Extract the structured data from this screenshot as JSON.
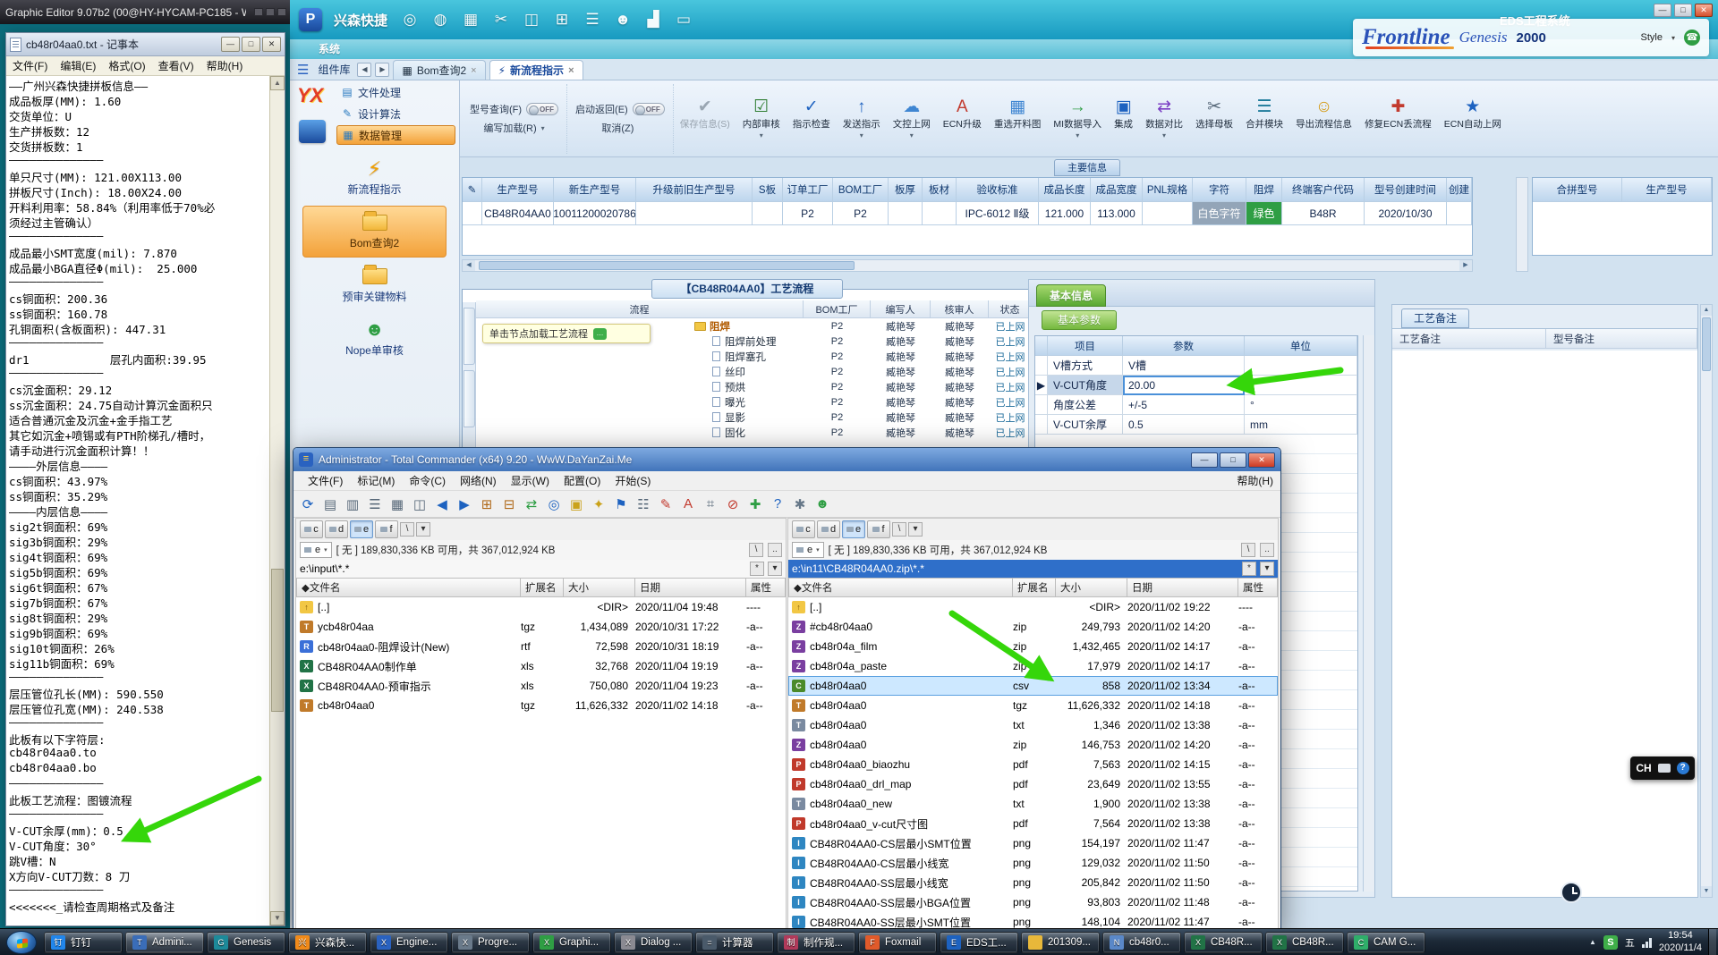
{
  "colors": {
    "arrow": "#35d60a",
    "teal": "#179ac0",
    "accent_orange": "#f3a23a",
    "selection_blue": "#cde8ff"
  },
  "graphic_editor": {
    "title": "Graphic Editor 9.07b2 (00@HY-HYCAM-PC185 - W..."
  },
  "notepad": {
    "title": "cb48r04aa0.txt - 记事本",
    "controls": [
      "—",
      "□",
      "✕"
    ],
    "menu": [
      "文件(F)",
      "编辑(E)",
      "格式(O)",
      "查看(V)",
      "帮助(H)"
    ],
    "lines": [
      "——广州兴森快捷拼板信息——",
      "成品板厚(MM): 1.60",
      "交货单位：U",
      "生产拼板数：12",
      "交货拼板数：1",
      "——————————————",
      "单只尺寸(MM): 121.00X113.00",
      "拼板尺寸(Inch): 18.00X24.00",
      "开料利用率：58.84%（利用率低于70%必",
      "须经过主管确认）",
      "——————————————",
      "成品最小SMT宽度(mil): 7.870",
      "成品最小BGA直径Φ(mil):  25.000",
      "——————————————",
      "cs铜面积：200.36",
      "ss铜面积：160.78",
      "孔铜面积(含板面积): 447.31",
      "——————————————",
      "dr1            层孔内面积:39.95",
      "——————————————",
      "cs沉金面积：29.12",
      "ss沉金面积：24.75自动计算沉金面积只",
      "适合普通沉金及沉金+金手指工艺",
      "其它如沉金+喷锡或有PTH阶梯孔/槽时，",
      "请手动进行沉金面积计算！！",
      "————外层信息————",
      "cs铜面积：43.97%",
      "ss铜面积：35.29%",
      "————内层信息————",
      "sig2t铜面积：69%",
      "sig3b铜面积：29%",
      "sig4t铜面积：69%",
      "sig5b铜面积：69%",
      "sig6t铜面积：67%",
      "sig7b铜面积：67%",
      "sig8t铜面积：29%",
      "sig9b铜面积：69%",
      "sig10t铜面积：26%",
      "sig11b铜面积：69%",
      "——————————————",
      "层压管位孔长(MM): 590.550",
      "层压管位孔宽(MM): 240.538",
      "——————————————",
      "此板有以下字符层:",
      "cb48r04aa0.to",
      "cb48r04aa0.bo",
      "——————————————",
      "此板工艺流程：图镀流程",
      "——————————————",
      "V-CUT余厚(mm)：0.5",
      "V-CUT角度：30°",
      "跳V槽：N",
      "X方向V-CUT刀数：8 刀",
      "——————————————",
      "<<<<<<<_请检查周期格式及备注"
    ]
  },
  "eds": {
    "title": "EDS工程系统",
    "logo": "P",
    "brandname": "兴森快捷",
    "controls": [
      "—",
      "□",
      "✕"
    ],
    "toolbar_icons": [
      {
        "n": "search-icon",
        "g": "◎"
      },
      {
        "n": "globe-icon",
        "g": "◍"
      },
      {
        "n": "table-icon",
        "g": "▦"
      },
      {
        "n": "cut-icon",
        "g": "✂"
      },
      {
        "n": "split-icon",
        "g": "◫"
      },
      {
        "n": "copy-icon",
        "g": "⊞"
      },
      {
        "n": "list-icon",
        "g": "☰"
      },
      {
        "n": "user-icon",
        "g": "☻"
      },
      {
        "n": "chart-icon",
        "g": "▟"
      },
      {
        "n": "window-icon",
        "g": "▭"
      }
    ],
    "frontline": {
      "name": "Frontline",
      "product": "Genesis",
      "year": "2000",
      "style": "Style",
      "caret": "▾",
      "phone": "☎"
    },
    "system_tab": "系统",
    "burger": "☰",
    "component_lib": "组件库",
    "nav_prev": "◀",
    "nav_next": "▶",
    "tabs": [
      {
        "g": "▦",
        "label": "Bom查询2",
        "close": "×",
        "cls": ""
      },
      {
        "g": "⚡",
        "label": "新流程指示",
        "close": "×",
        "cls": "active"
      }
    ],
    "toggles": [
      {
        "top": "型号查询(F)",
        "state": "OFF",
        "bottom": "编写加载(R)",
        "caret": "▾"
      },
      {
        "top": "启动返回(E)",
        "state": "OFF",
        "bottom": "取消(Z)",
        "caret": ""
      }
    ],
    "ribbon": [
      {
        "label": "保存信息(S)",
        "g": "✔",
        "c": "#9aa6b2",
        "caret": "",
        "cls": "disabled"
      },
      {
        "label": "内部审核",
        "g": "☑",
        "c": "#2f7d32",
        "caret": "▾",
        "cls": ""
      },
      {
        "label": "指示检查",
        "g": "✓",
        "c": "#1d62c0",
        "caret": "",
        "cls": ""
      },
      {
        "label": "发送指示",
        "g": "↑",
        "c": "#1d62c0",
        "caret": "▾",
        "cls": ""
      },
      {
        "label": "文控上网",
        "g": "☁",
        "c": "#3f86d2",
        "caret": "▾",
        "cls": ""
      },
      {
        "label": "ECN升级",
        "g": "A",
        "c": "#c23a2e",
        "caret": "",
        "cls": ""
      },
      {
        "label": "重选开料图",
        "g": "▦",
        "c": "#3f86d2",
        "caret": "",
        "cls": ""
      },
      {
        "label": "MI数据导入",
        "g": "→",
        "c": "#2f9e44",
        "caret": "▾",
        "cls": ""
      },
      {
        "label": "集成",
        "g": "▣",
        "c": "#1d62c0",
        "caret": "",
        "cls": ""
      },
      {
        "label": "数据对比",
        "g": "⇄",
        "c": "#7b3fc4",
        "caret": "▾",
        "cls": ""
      },
      {
        "label": "选择母板",
        "g": "✂",
        "c": "#556677",
        "caret": "",
        "cls": ""
      },
      {
        "label": "合并模块",
        "g": "☰",
        "c": "#1d7a9a",
        "caret": "",
        "cls": ""
      },
      {
        "label": "导出流程信息",
        "g": "☺",
        "c": "#d49a12",
        "caret": "",
        "cls": ""
      },
      {
        "label": "修复ECN丢流程",
        "g": "✚",
        "c": "#c23a2e",
        "caret": "",
        "cls": ""
      },
      {
        "label": "ECN自动上网",
        "g": "★",
        "c": "#1d62c0",
        "caret": "",
        "cls": ""
      }
    ],
    "sidebar": {
      "logo": "YX",
      "menu": [
        {
          "label": "文件处理",
          "g": "▤",
          "cls": ""
        },
        {
          "label": "设计算法",
          "g": "✎",
          "cls": ""
        },
        {
          "label": "数据管理",
          "g": "▦",
          "cls": "sel"
        }
      ],
      "items": [
        {
          "label": "新流程指示",
          "icon": "itm-bolt",
          "cls": ""
        },
        {
          "label": "Bom查询2",
          "icon": "itm-folder",
          "cls": "sel"
        },
        {
          "label": "预审关键物料",
          "icon": "itm-folder",
          "cls": ""
        },
        {
          "label": "Nope单审核",
          "icon": "itm-person",
          "cls": ""
        }
      ]
    },
    "main_info": "主要信息",
    "grid": {
      "gutter_glyph": "✎",
      "headers": [
        "生产型号",
        "新生产型号",
        "升级前旧生产型号",
        "S板",
        "订单工厂",
        "BOM工厂",
        "板厚",
        "板材",
        "验收标准",
        "成品长度",
        "成品宽度",
        "PNL规格",
        "字符",
        "阻焊",
        "终端客户代码",
        "型号创建时间",
        "创建"
      ],
      "row": {
        "c0": "CB48R04AA0",
        "c1": "10011200020786",
        "c2": "",
        "c3": "",
        "c4": "P2",
        "c5": "P2",
        "c6": "",
        "c7": "",
        "c8": "IPC-6012 Ⅱ级",
        "c9": "121.000",
        "c10": "113.000",
        "c11": "",
        "c12": "白色字符",
        "c13": "绿色",
        "c14": "B48R",
        "c15": "2020/10/30",
        "c16": ""
      },
      "extra_headers": [
        "合拼型号",
        "生产型号"
      ]
    },
    "process": {
      "title": "【CB48R04AA0】工艺流程",
      "headers": [
        "流程",
        "BOM工厂",
        "编写人",
        "核审人",
        "状态"
      ],
      "tooltip": "单击节点加载工艺流程",
      "rows": [
        {
          "name": "阻焊",
          "lvl": "lvl0",
          "icon": "node-folder",
          "f": "P2",
          "w": "臧艳琴",
          "r": "臧艳琴",
          "s": "已上网"
        },
        {
          "name": "阻焊前处理",
          "lvl": "lvl1",
          "icon": "node-doc",
          "f": "P2",
          "w": "臧艳琴",
          "r": "臧艳琴",
          "s": "已上网"
        },
        {
          "name": "阻焊塞孔",
          "lvl": "lvl1",
          "icon": "node-doc",
          "f": "P2",
          "w": "臧艳琴",
          "r": "臧艳琴",
          "s": "已上网"
        },
        {
          "name": "丝印",
          "lvl": "lvl1",
          "icon": "node-doc",
          "f": "P2",
          "w": "臧艳琴",
          "r": "臧艳琴",
          "s": "已上网"
        },
        {
          "name": "预烘",
          "lvl": "lvl1",
          "icon": "node-doc",
          "f": "P2",
          "w": "臧艳琴",
          "r": "臧艳琴",
          "s": "已上网"
        },
        {
          "name": "曝光",
          "lvl": "lvl1",
          "icon": "node-doc",
          "f": "P2",
          "w": "臧艳琴",
          "r": "臧艳琴",
          "s": "已上网"
        },
        {
          "name": "显影",
          "lvl": "lvl1",
          "icon": "node-doc",
          "f": "P2",
          "w": "臧艳琴",
          "r": "臧艳琴",
          "s": "已上网"
        },
        {
          "name": "固化",
          "lvl": "lvl1",
          "icon": "node-doc",
          "f": "P2",
          "w": "臧艳琴",
          "r": "臧艳琴",
          "s": "已上网"
        }
      ]
    },
    "basic": {
      "tab": "基本信息",
      "param_tab": "基本参数",
      "headers": [
        "",
        "项目",
        "参数",
        "单位"
      ],
      "rows": [
        {
          "gut": "",
          "item": "V槽方式",
          "value": "V槽",
          "unit": "",
          "cls": ""
        },
        {
          "gut": "▶",
          "item": "V-CUT角度",
          "value": "20.00",
          "unit": "",
          "cls": "selected"
        },
        {
          "gut": "",
          "item": "角度公差",
          "value": "+/-5",
          "unit": "°",
          "cls": ""
        },
        {
          "gut": "",
          "item": "V-CUT余厚",
          "value": "0.5",
          "unit": "mm",
          "cls": ""
        }
      ]
    },
    "notes": {
      "tab": "工艺备注",
      "col1": "工艺备注",
      "col2": "型号备注"
    }
  },
  "tc": {
    "title": "Administrator - Total Commander (x64) 9.20 - WwW.DaYanZai.Me",
    "controls": [
      "—",
      "□",
      "✕"
    ],
    "menu": [
      "文件(F)",
      "标记(M)",
      "命令(C)",
      "网络(N)",
      "显示(W)",
      "配置(O)",
      "开始(S)"
    ],
    "help": "帮助(H)",
    "toolbar_icons": [
      {
        "n": "refresh-icon",
        "g": "⟳",
        "c": "#1d62c0"
      },
      {
        "n": "brief-view-icon",
        "g": "▤",
        "c": "#556677"
      },
      {
        "n": "detail-view-icon",
        "g": "▥",
        "c": "#556677"
      },
      {
        "n": "list-view-icon",
        "g": "☰",
        "c": "#556677"
      },
      {
        "n": "thumbs-icon",
        "g": "▦",
        "c": "#556677"
      },
      {
        "n": "split-icon",
        "g": "◫",
        "c": "#556677"
      },
      {
        "n": "back-icon",
        "g": "◀",
        "c": "#1d62c0"
      },
      {
        "n": "forward-icon",
        "g": "▶",
        "c": "#1d62c0"
      },
      {
        "n": "pack-icon",
        "g": "⊞",
        "c": "#b06a1a"
      },
      {
        "n": "unpack-icon",
        "g": "⊟",
        "c": "#b06a1a"
      },
      {
        "n": "sync-icon",
        "g": "⇄",
        "c": "#2f9e44"
      },
      {
        "n": "search-icon",
        "g": "◎",
        "c": "#1d62c0"
      },
      {
        "n": "folders-icon",
        "g": "▣",
        "c": "#caa21a"
      },
      {
        "n": "favorites-icon",
        "g": "✦",
        "c": "#caa21a"
      },
      {
        "n": "ftp-icon",
        "g": "⚑",
        "c": "#1d62c0"
      },
      {
        "n": "multi-rename-icon",
        "g": "☷",
        "c": "#556677"
      },
      {
        "n": "edit-icon",
        "g": "✎",
        "c": "#c23a2e"
      },
      {
        "n": "attributes-icon",
        "g": "A",
        "c": "#c23a2e"
      },
      {
        "n": "grid-icon",
        "g": "⌗",
        "c": "#556677"
      },
      {
        "n": "block-icon",
        "g": "⊘",
        "c": "#c23a2e"
      },
      {
        "n": "add-icon",
        "g": "✚",
        "c": "#2f9e44"
      },
      {
        "n": "help-icon",
        "g": "?",
        "c": "#1d62c0"
      },
      {
        "n": "settings-icon",
        "g": "✱",
        "c": "#667788"
      },
      {
        "n": "user-icon",
        "g": "☻",
        "c": "#2f9e44"
      }
    ],
    "drives": [
      {
        "l": "c",
        "cls": ""
      },
      {
        "l": "d",
        "cls": ""
      },
      {
        "l": "e",
        "cls": "active"
      },
      {
        "l": "f",
        "cls": ""
      }
    ],
    "minis": {
      "root": "\\",
      "up": "..",
      "star": "*",
      "hist": "▾"
    },
    "left": {
      "drive": "e",
      "caret": "▾",
      "info": "[ 无 ] 189,830,336 KB 可用，共 367,012,924 KB",
      "path": "e:\\input\\*.*",
      "headers": [
        "◆文件名",
        "扩展名",
        "大小",
        "日期",
        "属性"
      ],
      "rows": [
        {
          "icon": "ico-updir",
          "name": "[..]",
          "ext": "",
          "size": "<DIR>",
          "date": "2020/11/04 19:48",
          "attr": "----",
          "cls": ""
        },
        {
          "icon": "ico-tgz",
          "name": "ycb48r04aa",
          "ext": "tgz",
          "size": "1,434,089",
          "date": "2020/10/31 17:22",
          "attr": "-a--",
          "cls": ""
        },
        {
          "icon": "ico-rtf",
          "name": "cb48r04aa0-阻焊设计(New)",
          "ext": "rtf",
          "size": "72,598",
          "date": "2020/10/31 18:19",
          "attr": "-a--",
          "cls": ""
        },
        {
          "icon": "ico-xls",
          "name": "CB48R04AA0制作单",
          "ext": "xls",
          "size": "32,768",
          "date": "2020/11/04 19:19",
          "attr": "-a--",
          "cls": ""
        },
        {
          "icon": "ico-xls",
          "name": "CB48R04AA0-预审指示",
          "ext": "xls",
          "size": "750,080",
          "date": "2020/11/04 19:23",
          "attr": "-a--",
          "cls": ""
        },
        {
          "icon": "ico-tgz",
          "name": "cb48r04aa0",
          "ext": "tgz",
          "size": "11,626,332",
          "date": "2020/11/02 14:18",
          "attr": "-a--",
          "cls": ""
        }
      ]
    },
    "right": {
      "drive": "e",
      "caret": "▾",
      "info": "[ 无 ] 189,830,336 KB 可用，共 367,012,924 KB",
      "path": "e:\\in11\\CB48R04AA0.zip\\*.*",
      "headers": [
        "◆文件名",
        "扩展名",
        "大小",
        "日期",
        "属性"
      ],
      "rows": [
        {
          "icon": "ico-updir",
          "name": "[..]",
          "ext": "",
          "size": "<DIR>",
          "date": "2020/11/02 19:22",
          "attr": "----",
          "cls": ""
        },
        {
          "icon": "ico-zip",
          "name": "#cb48r04aa0",
          "ext": "zip",
          "size": "249,793",
          "date": "2020/11/02 14:20",
          "attr": "-a--",
          "cls": ""
        },
        {
          "icon": "ico-zip",
          "name": "cb48r04a_film",
          "ext": "zip",
          "size": "1,432,465",
          "date": "2020/11/02 14:17",
          "attr": "-a--",
          "cls": ""
        },
        {
          "icon": "ico-zip",
          "name": "cb48r04a_paste",
          "ext": "zip",
          "size": "17,979",
          "date": "2020/11/02 14:17",
          "attr": "-a--",
          "cls": ""
        },
        {
          "icon": "ico-csv",
          "name": "cb48r04aa0",
          "ext": "csv",
          "size": "858",
          "date": "2020/11/02 13:34",
          "attr": "-a--",
          "cls": "selected"
        },
        {
          "icon": "ico-tgz",
          "name": "cb48r04aa0",
          "ext": "tgz",
          "size": "11,626,332",
          "date": "2020/11/02 14:18",
          "attr": "-a--",
          "cls": ""
        },
        {
          "icon": "ico-txt",
          "name": "cb48r04aa0",
          "ext": "txt",
          "size": "1,346",
          "date": "2020/11/02 13:38",
          "attr": "-a--",
          "cls": ""
        },
        {
          "icon": "ico-zip",
          "name": "cb48r04aa0",
          "ext": "zip",
          "size": "146,753",
          "date": "2020/11/02 14:20",
          "attr": "-a--",
          "cls": ""
        },
        {
          "icon": "ico-pdf",
          "name": "cb48r04aa0_biaozhu",
          "ext": "pdf",
          "size": "7,563",
          "date": "2020/11/02 14:15",
          "attr": "-a--",
          "cls": ""
        },
        {
          "icon": "ico-pdf",
          "name": "cb48r04aa0_drl_map",
          "ext": "pdf",
          "size": "23,649",
          "date": "2020/11/02 13:55",
          "attr": "-a--",
          "cls": ""
        },
        {
          "icon": "ico-txt",
          "name": "cb48r04aa0_new",
          "ext": "txt",
          "size": "1,900",
          "date": "2020/11/02 13:38",
          "attr": "-a--",
          "cls": ""
        },
        {
          "icon": "ico-pdf",
          "name": "cb48r04aa0_v-cut尺寸图",
          "ext": "pdf",
          "size": "7,564",
          "date": "2020/11/02 13:38",
          "attr": "-a--",
          "cls": ""
        },
        {
          "icon": "ico-png",
          "name": "CB48R04AA0-CS层最小SMT位置",
          "ext": "png",
          "size": "154,197",
          "date": "2020/11/02 11:47",
          "attr": "-a--",
          "cls": ""
        },
        {
          "icon": "ico-png",
          "name": "CB48R04AA0-CS层最小线宽",
          "ext": "png",
          "size": "129,032",
          "date": "2020/11/02 11:50",
          "attr": "-a--",
          "cls": ""
        },
        {
          "icon": "ico-png",
          "name": "CB48R04AA0-SS层最小线宽",
          "ext": "png",
          "size": "205,842",
          "date": "2020/11/02 11:50",
          "attr": "-a--",
          "cls": ""
        },
        {
          "icon": "ico-png",
          "name": "CB48R04AA0-SS层最小BGA位置",
          "ext": "png",
          "size": "93,803",
          "date": "2020/11/02 11:48",
          "attr": "-a--",
          "cls": ""
        },
        {
          "icon": "ico-png",
          "name": "CB48R04AA0-SS层最小SMT位置",
          "ext": "png",
          "size": "148,104",
          "date": "2020/11/02 11:47",
          "attr": "-a--",
          "cls": ""
        }
      ]
    }
  },
  "taskbar": {
    "buttons": [
      {
        "label": "钉钉",
        "icon": "tb-ding",
        "cls": ""
      },
      {
        "label": "Admini...",
        "icon": "tb-tc",
        "cls": "active"
      },
      {
        "label": "Genesis",
        "icon": "tb-gen",
        "cls": ""
      },
      {
        "label": "兴森快...",
        "icon": "tb-xs",
        "cls": ""
      },
      {
        "label": "Engine...",
        "icon": "tb-eng",
        "cls": ""
      },
      {
        "label": "Progre...",
        "icon": "tb-pro",
        "cls": ""
      },
      {
        "label": "Graphi...",
        "icon": "tb-gra",
        "cls": ""
      },
      {
        "label": "Dialog ...",
        "icon": "tb-dlg",
        "cls": ""
      },
      {
        "label": "计算器",
        "icon": "tb-calc",
        "cls": ""
      },
      {
        "label": "制作规...",
        "icon": "tb-mk",
        "cls": ""
      },
      {
        "label": "Foxmail",
        "icon": "tb-fox",
        "cls": ""
      },
      {
        "label": "EDS工...",
        "icon": "tb-eds",
        "cls": ""
      },
      {
        "label": "201309...",
        "icon": "tb-folder",
        "cls": ""
      },
      {
        "label": "cb48r0...",
        "icon": "tb-note",
        "cls": ""
      },
      {
        "label": "CB48R...",
        "icon": "tb-xls",
        "cls": ""
      },
      {
        "label": "CB48R...",
        "icon": "tb-xls",
        "cls": ""
      },
      {
        "label": "CAM G...",
        "icon": "tb-cam",
        "cls": ""
      }
    ],
    "tray": {
      "expand": "▲",
      "sogou": "S",
      "ime": "五",
      "time": "19:54",
      "date": "2020/11/4"
    }
  },
  "ime_box": {
    "label": "CH",
    "help": "?"
  }
}
